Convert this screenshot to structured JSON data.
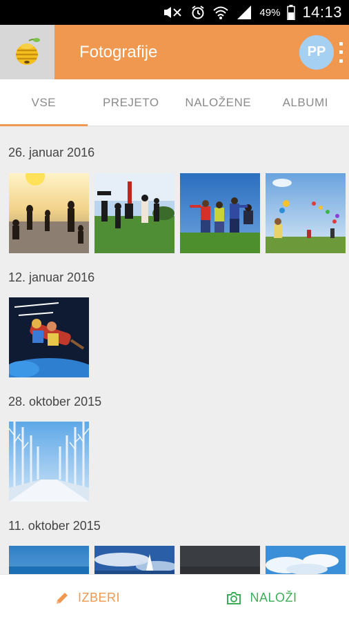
{
  "status": {
    "battery": "49%",
    "time": "14:13"
  },
  "header": {
    "title": "Fotografije",
    "avatar_initials": "PP",
    "accent": "#f0984f"
  },
  "tabs": [
    {
      "label": "VSE",
      "active": true
    },
    {
      "label": "PREJETO",
      "active": false
    },
    {
      "label": "NALOŽENE",
      "active": false
    },
    {
      "label": "ALBUMI",
      "active": false
    }
  ],
  "groups": [
    {
      "date": "26. januar 2016",
      "photos": [
        "sunset-silhouettes",
        "kids-cartwheels",
        "kids-circle",
        "kid-balloons"
      ]
    },
    {
      "date": "12. januar 2016",
      "photos": [
        "holiday-card"
      ]
    },
    {
      "date": "28. oktober 2015",
      "photos": [
        "winter-road"
      ]
    },
    {
      "date": "11. oktober 2015",
      "photos": [
        "sea",
        "sailboat-sky",
        "dark-sky",
        "clouds"
      ]
    }
  ],
  "bottom": {
    "select_label": "IZBERI",
    "upload_label": "NALOŽI",
    "select_color": "#f0984f",
    "upload_color": "#3dae57"
  }
}
